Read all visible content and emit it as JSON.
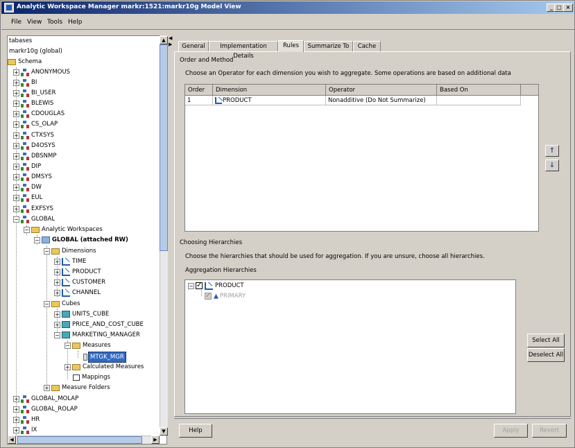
{
  "window": {
    "title": "Analytic Workspace Manager  markr:1521:markr10g  Model View",
    "controls": [
      "_",
      "□",
      "×"
    ]
  },
  "menu": [
    {
      "label": "File"
    },
    {
      "label": "View"
    },
    {
      "label": "Tools"
    },
    {
      "label": "Help"
    }
  ],
  "tree": {
    "items": [
      {
        "label": "tabases"
      },
      {
        "label": "markr10g (global)"
      },
      {
        "label": "Schema"
      },
      {
        "label": "ANONYMOUS"
      },
      {
        "label": "BI"
      },
      {
        "label": "BI_USER"
      },
      {
        "label": "BLEWIS"
      },
      {
        "label": "CDOUGLAS"
      },
      {
        "label": "CS_OLAP"
      },
      {
        "label": "CTXSYS"
      },
      {
        "label": "D4OSYS"
      },
      {
        "label": "DBSNMP"
      },
      {
        "label": "DIP"
      },
      {
        "label": "DMSYS"
      },
      {
        "label": "DW"
      },
      {
        "label": "EUL"
      },
      {
        "label": "EXFSYS"
      },
      {
        "label": "GLOBAL"
      },
      {
        "label": "Analytic Workspaces"
      },
      {
        "label": "GLOBAL (attached RW)"
      },
      {
        "label": "Dimensions"
      },
      {
        "label": "TIME"
      },
      {
        "label": "PRODUCT"
      },
      {
        "label": "CUSTOMER"
      },
      {
        "label": "CHANNEL"
      },
      {
        "label": "Cubes"
      },
      {
        "label": "UNITS_CUBE"
      },
      {
        "label": "PRICE_AND_COST_CUBE"
      },
      {
        "label": "MARKETING_MANAGER"
      },
      {
        "label": "Measures"
      },
      {
        "label": "MTGK_MGR"
      },
      {
        "label": "Calculated Measures"
      },
      {
        "label": "Mappings"
      },
      {
        "label": "Measure Folders"
      },
      {
        "label": "GLOBAL_MOLAP"
      },
      {
        "label": "GLOBAL_ROLAP"
      },
      {
        "label": "HR"
      },
      {
        "label": "IX"
      }
    ]
  },
  "tabs": [
    {
      "label": "General"
    },
    {
      "label": "Implementation Details"
    },
    {
      "label": "Rules"
    },
    {
      "label": "Summarize To"
    },
    {
      "label": "Cache"
    }
  ],
  "rules": {
    "section_title": "Order and Method",
    "instruction": "Choose an Operator for each dimension you wish to aggregate. Some operations are based on additional data",
    "columns": [
      "Order",
      "Dimension",
      "Operator",
      "Based On"
    ],
    "rows": [
      {
        "order": "1",
        "dimension": "PRODUCT",
        "operator": "Nonadditive (Do Not Summarize)",
        "based_on": ""
      }
    ],
    "move_up": "↑",
    "move_down": "↓"
  },
  "hierarchies": {
    "section_title": "Choosing Hierarchies",
    "instruction": "Choose the hierarchies that should be used for aggregation. If you are unsure, choose all hierarchies.",
    "list_label": "Aggregation Hierarchies",
    "dimension": "PRODUCT",
    "hierarchy": "PRIMARY",
    "select_all": "Select All",
    "deselect_all": "Deselect All"
  },
  "footer": {
    "help": "Help",
    "apply": "Apply",
    "revert": "Revert"
  }
}
